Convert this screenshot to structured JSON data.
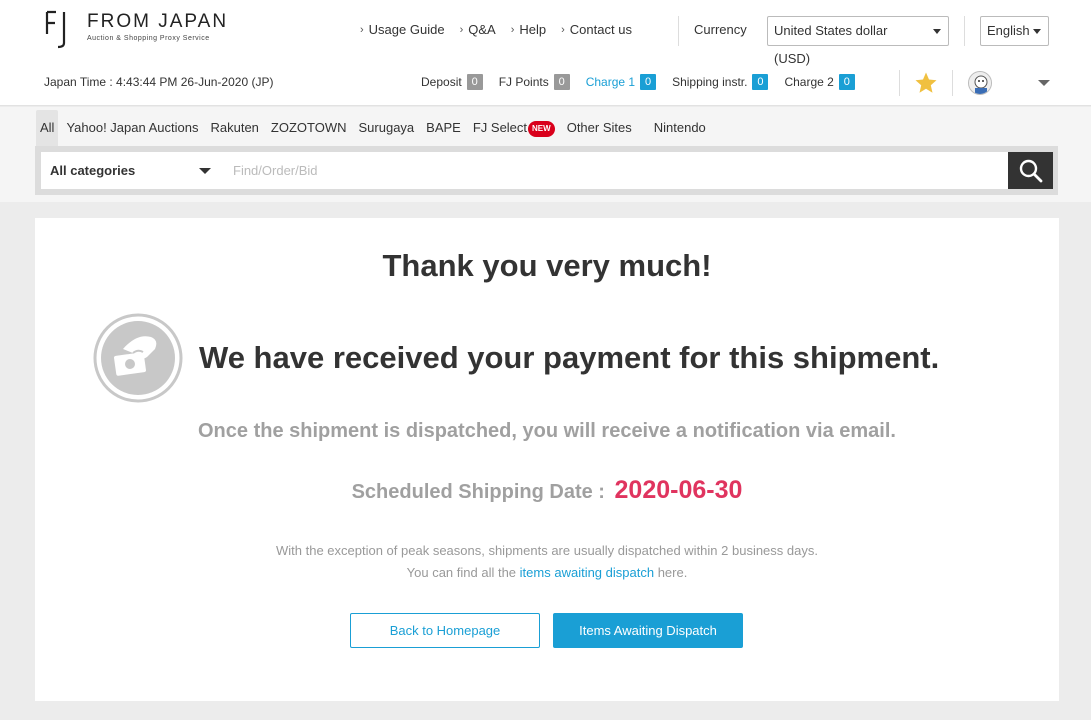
{
  "header": {
    "logo_name": "FROM JAPAN",
    "logo_tagline": "Auction & Shopping Proxy Service",
    "links": [
      "Usage Guide",
      "Q&A",
      "Help",
      "Contact us"
    ],
    "currency_label": "Currency",
    "currency_value": "United States dollar (USD)",
    "language_value": "English",
    "japan_time": "Japan Time : 4:43:44 PM 26-Jun-2020 (JP)",
    "stats": [
      {
        "label": "Deposit",
        "count": "0"
      },
      {
        "label": "FJ Points",
        "count": "0"
      },
      {
        "label": "Charge 1",
        "count": "0"
      },
      {
        "label": "Shipping instr.",
        "count": "0"
      },
      {
        "label": "Charge 2",
        "count": "0"
      }
    ],
    "favorites_icon": "star-icon",
    "account_icon": "avatar"
  },
  "site_tabs": [
    "All",
    "Yahoo! Japan Auctions",
    "Rakuten",
    "ZOZOTOWN",
    "Surugaya",
    "BAPE",
    "FJ Select",
    "Other Sites",
    "Nintendo"
  ],
  "new_badge": "NEW",
  "search": {
    "category": "All categories",
    "placeholder": "Find/Order/Bid"
  },
  "main": {
    "thanks": "Thank you very much!",
    "received": "We have received your payment for this shipment.",
    "notice": "Once the shipment is dispatched, you will receive a notification via email.",
    "ship_label": "Scheduled Shipping Date :",
    "ship_date": "2020-06-30",
    "info_line1": "With the exception of peak seasons, shipments are usually dispatched within 2 business days.",
    "info_line2_pre": "You can find all the",
    "info_line2_link": "items awaiting dispatch",
    "info_line2_post": "here.",
    "btn_home": "Back to Homepage",
    "btn_dispatch": "Items Awaiting Dispatch"
  },
  "colors": {
    "accent": "#1a9fd5",
    "date": "#e0345f",
    "new_badge": "#d9001b"
  }
}
